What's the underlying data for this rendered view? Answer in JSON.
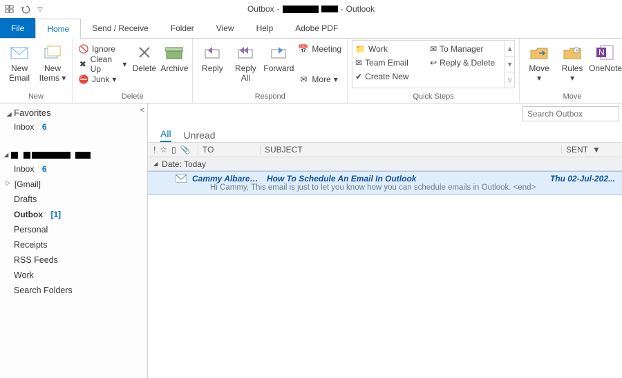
{
  "title": {
    "part1": "Outbox",
    "sep": "-",
    "tail": "Outlook"
  },
  "tabs": {
    "file": "File",
    "home": "Home",
    "sendrecv": "Send / Receive",
    "folder": "Folder",
    "view": "View",
    "help": "Help",
    "adobe": "Adobe PDF"
  },
  "ribbon": {
    "new": {
      "label": "New",
      "email": "New Email",
      "items": "New Items"
    },
    "delete": {
      "label": "Delete",
      "ignore": "Ignore",
      "cleanup": "Clean Up",
      "junk": "Junk",
      "delete": "Delete",
      "archive": "Archive"
    },
    "respond": {
      "label": "Respond",
      "reply": "Reply",
      "replyall": "Reply All",
      "forward": "Forward",
      "meeting": "Meeting",
      "more": "More"
    },
    "quicksteps": {
      "label": "Quick Steps",
      "work": "Work",
      "tomgr": "To Manager",
      "team": "Team Email",
      "rd": "Reply & Delete",
      "create": "Create New"
    },
    "move": {
      "label": "Move",
      "move": "Move",
      "rules": "Rules",
      "onenote": "OneNote"
    }
  },
  "nav": {
    "favorites": "Favorites",
    "inbox": "Inbox",
    "inbox_count": "6",
    "gmail": "[Gmail]",
    "drafts": "Drafts",
    "outbox": "Outbox",
    "outbox_count": "[1]",
    "personal": "Personal",
    "receipts": "Receipts",
    "rss": "RSS Feeds",
    "workf": "Work",
    "search": "Search Folders"
  },
  "content": {
    "search_ph": "Search Outbox",
    "filter_all": "All",
    "filter_unread": "Unread",
    "col_to": "TO",
    "col_subject": "SUBJECT",
    "col_sent": "SENT",
    "group": "Date: Today",
    "mail": {
      "to": "Cammy Albares...",
      "subject": "How To Schedule An Email In Outlook",
      "sent": "Thu 02-Jul-202...",
      "preview": "Hi Cammy,  This email is just to let you know how you can schedule emails in Outlook.   <end>"
    }
  }
}
